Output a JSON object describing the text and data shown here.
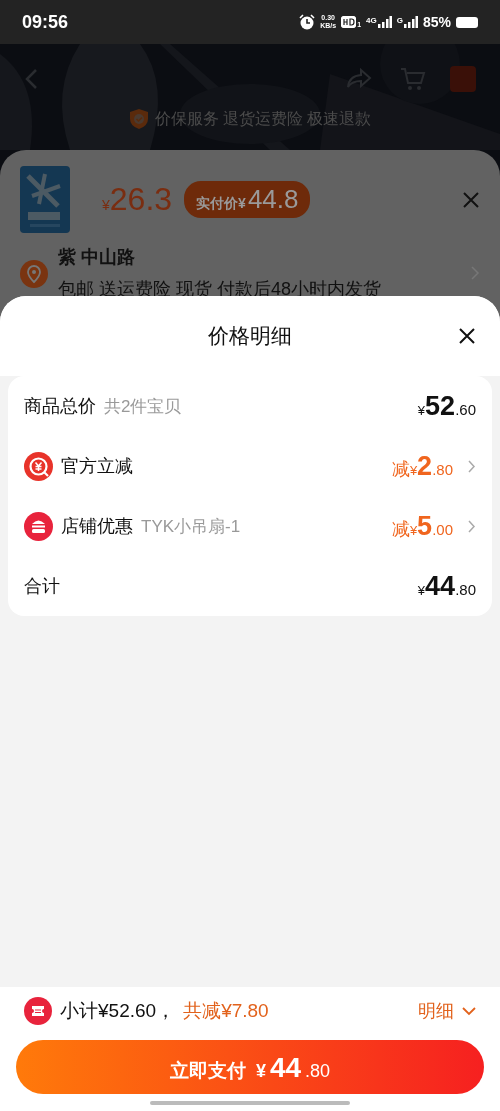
{
  "status_bar": {
    "time": "09:56",
    "net_speed_value": "0.30",
    "net_speed_unit": "KB/s",
    "hd_index": "1",
    "network_1": "4G",
    "network_2": "G",
    "battery": "85%"
  },
  "background_page": {
    "service_text": "价保服务 退货运费险 极速退款"
  },
  "product_sheet": {
    "price_currency": "¥",
    "price": "26.3",
    "paid_label": "实付价",
    "paid_currency": "¥",
    "paid_amount": "44.8",
    "address": "紫 中山路",
    "shipping": "包邮  送运费险  现货   付款后48小时内发货"
  },
  "price_detail": {
    "title": "价格明细",
    "rows": [
      {
        "kind": "plain",
        "label": "商品总价",
        "note": "共2件宝贝",
        "currency": "¥",
        "integer": "52",
        "decimal": ".60"
      },
      {
        "kind": "coupon",
        "label": "官方立减",
        "prefix": "减",
        "currency": "¥",
        "integer": "2",
        "decimal": ".80"
      },
      {
        "kind": "shop",
        "label": "店铺优惠",
        "note": "TYK小吊扇-1",
        "prefix": "减",
        "currency": "¥",
        "integer": "5",
        "decimal": ".00"
      },
      {
        "kind": "plain",
        "label": "合计",
        "currency": "¥",
        "integer": "44",
        "decimal": ".80"
      }
    ]
  },
  "footer": {
    "subtotal": "小计¥52.60，",
    "discount": "共减¥7.80",
    "detail_link": "明细",
    "pay_button": {
      "label": "立即支付",
      "currency": "¥",
      "integer": "44",
      "decimal": ".80"
    }
  }
}
